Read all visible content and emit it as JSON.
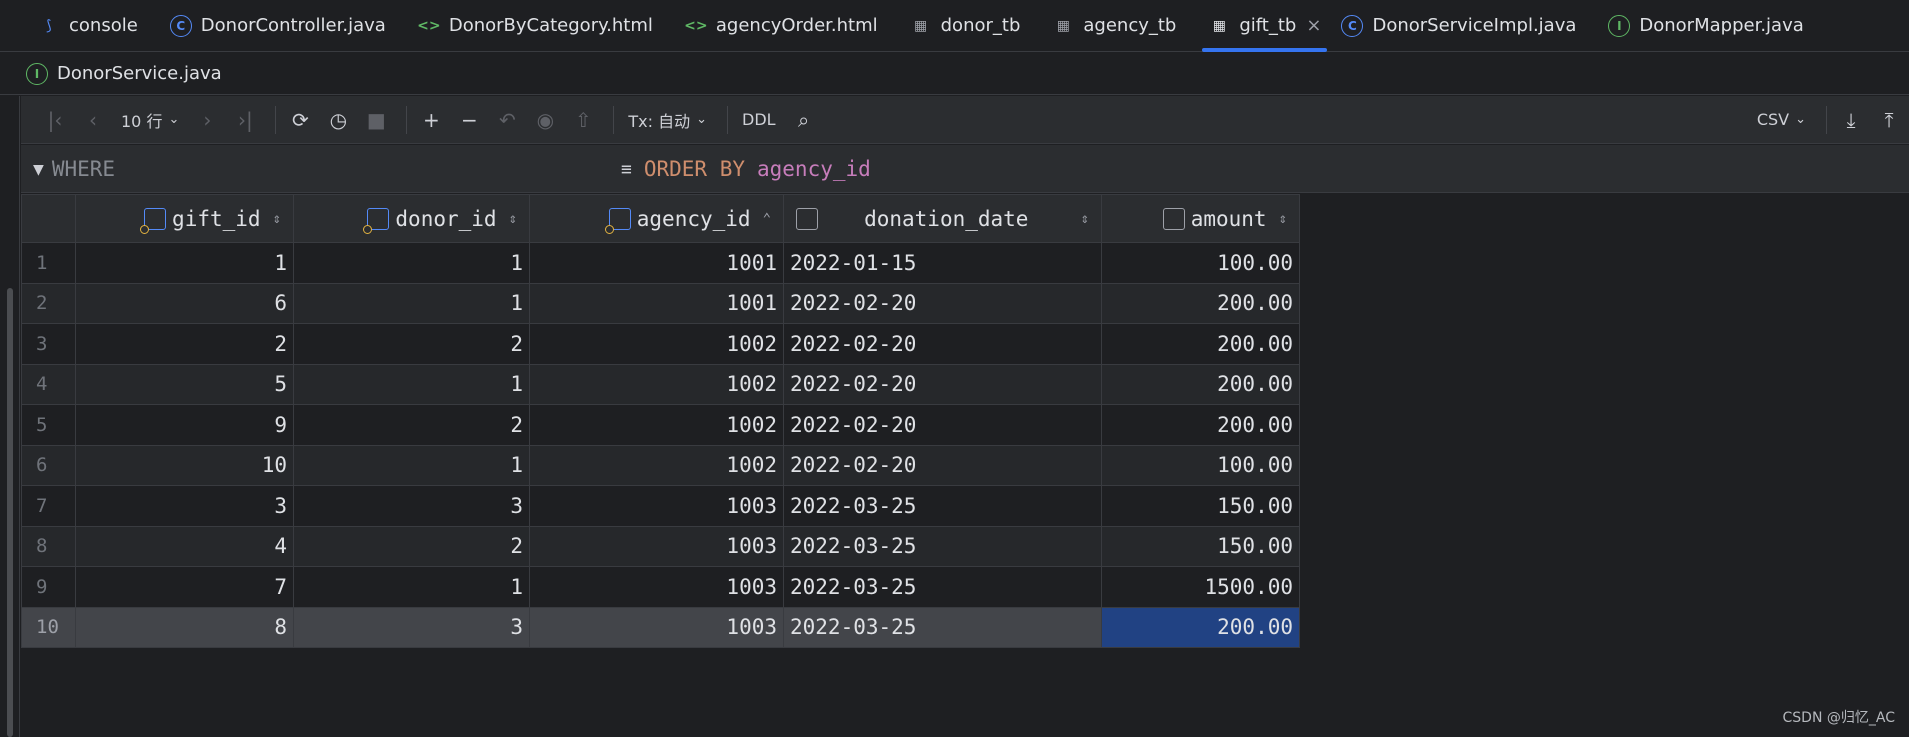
{
  "tabs": [
    {
      "label": "console",
      "icon": "console-icon"
    },
    {
      "label": "DonorController.java",
      "icon": "class-icon"
    },
    {
      "label": "DonorByCategory.html",
      "icon": "html-icon"
    },
    {
      "label": "agencyOrder.html",
      "icon": "html-icon"
    },
    {
      "label": "donor_tb",
      "icon": "table-icon"
    },
    {
      "label": "agency_tb",
      "icon": "table-icon"
    },
    {
      "label": "gift_tb",
      "icon": "table-icon",
      "active": true
    },
    {
      "label": "DonorServiceImpl.java",
      "icon": "class-icon"
    },
    {
      "label": "DonorMapper.java",
      "icon": "interface-icon"
    }
  ],
  "tabs_row2": [
    {
      "label": "DonorService.java",
      "icon": "interface-icon"
    }
  ],
  "toolbar": {
    "page_size": "10 行",
    "tx_mode": "Tx: 自动",
    "ddl_label": "DDL",
    "export_format": "CSV"
  },
  "filter": {
    "where_label": "WHERE",
    "order_keyword": "ORDER BY",
    "order_column": "agency_id"
  },
  "columns": [
    "gift_id",
    "donor_id",
    "agency_id",
    "donation_date",
    "amount"
  ],
  "rows": [
    {
      "n": "1",
      "gift_id": "1",
      "donor_id": "1",
      "agency_id": "1001",
      "donation_date": "2022-01-15",
      "amount": "100.00"
    },
    {
      "n": "2",
      "gift_id": "6",
      "donor_id": "1",
      "agency_id": "1001",
      "donation_date": "2022-02-20",
      "amount": "200.00"
    },
    {
      "n": "3",
      "gift_id": "2",
      "donor_id": "2",
      "agency_id": "1002",
      "donation_date": "2022-02-20",
      "amount": "200.00"
    },
    {
      "n": "4",
      "gift_id": "5",
      "donor_id": "1",
      "agency_id": "1002",
      "donation_date": "2022-02-20",
      "amount": "200.00"
    },
    {
      "n": "5",
      "gift_id": "9",
      "donor_id": "2",
      "agency_id": "1002",
      "donation_date": "2022-02-20",
      "amount": "200.00"
    },
    {
      "n": "6",
      "gift_id": "10",
      "donor_id": "1",
      "agency_id": "1002",
      "donation_date": "2022-02-20",
      "amount": "100.00"
    },
    {
      "n": "7",
      "gift_id": "3",
      "donor_id": "3",
      "agency_id": "1003",
      "donation_date": "2022-03-25",
      "amount": "150.00"
    },
    {
      "n": "8",
      "gift_id": "4",
      "donor_id": "2",
      "agency_id": "1003",
      "donation_date": "2022-03-25",
      "amount": "150.00"
    },
    {
      "n": "9",
      "gift_id": "7",
      "donor_id": "1",
      "agency_id": "1003",
      "donation_date": "2022-03-25",
      "amount": "1500.00"
    },
    {
      "n": "10",
      "gift_id": "8",
      "donor_id": "3",
      "agency_id": "1003",
      "donation_date": "2022-03-25",
      "amount": "200.00"
    }
  ],
  "watermark": "CSDN @归忆_AC"
}
